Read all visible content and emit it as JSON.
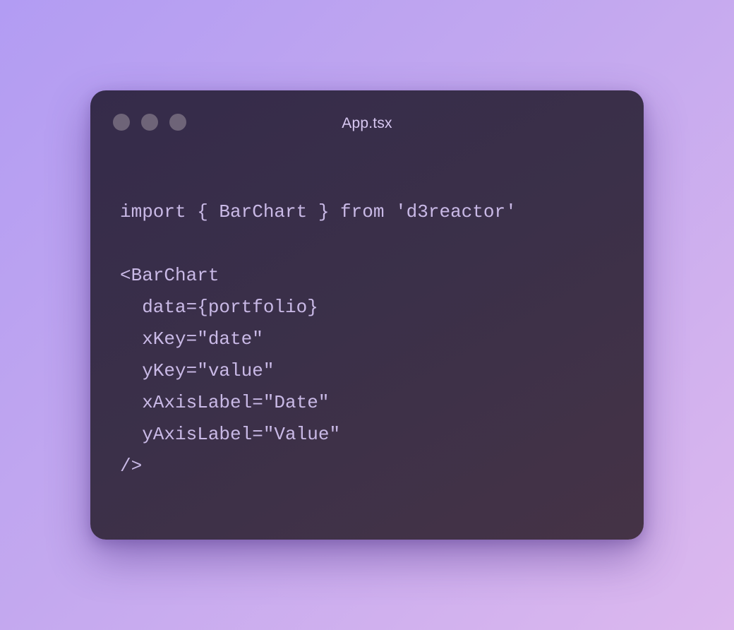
{
  "window": {
    "title": "App.tsx",
    "controls": [
      {
        "name": "close-dot",
        "icon": "circle"
      },
      {
        "name": "minimize-dot",
        "icon": "circle"
      },
      {
        "name": "maximize-dot",
        "icon": "circle"
      }
    ]
  },
  "code": {
    "lines": [
      "import { BarChart } from 'd3reactor'",
      "",
      "<BarChart",
      "  data={portfolio}",
      "  xKey=\"date\"",
      "  yKey=\"value\"",
      "  xAxisLabel=\"Date\"",
      "  yAxisLabel=\"Value\"",
      "/>"
    ]
  },
  "colors": {
    "background_start": "#b29cf3",
    "background_end": "#dcb8ee",
    "window_bg": "#3b3049",
    "code_text": "#c9b9e6",
    "control_dot": "#6e6478"
  }
}
